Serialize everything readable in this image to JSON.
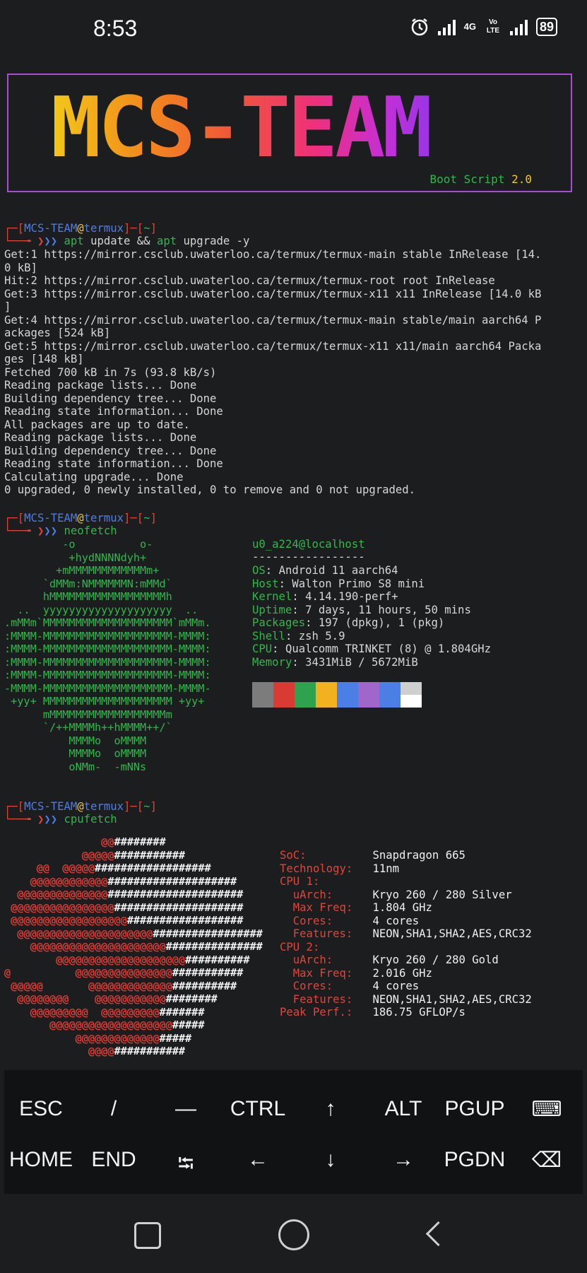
{
  "status_bar": {
    "time": "8:53",
    "network1": "4G",
    "network2": "Vo LTE",
    "battery": "89"
  },
  "banner": {
    "title": "MCS-TEAM",
    "subtitle_prefix": "Boot Script",
    "subtitle_version": "2.0"
  },
  "prompt": {
    "user": "MCS-TEAM",
    "at": "@",
    "host": "termux",
    "dir": "~"
  },
  "session1": {
    "cmd_apt1": "apt",
    "cmd_mid": " update && ",
    "cmd_apt2": "apt",
    "cmd_end": " upgrade -y",
    "output": [
      "Get:1 https://mirror.csclub.uwaterloo.ca/termux/termux-main stable InRelease [14.",
      "0 kB]",
      "Hit:2 https://mirror.csclub.uwaterloo.ca/termux/termux-root root InRelease",
      "Get:3 https://mirror.csclub.uwaterloo.ca/termux/termux-x11 x11 InRelease [14.0 kB",
      "]",
      "Get:4 https://mirror.csclub.uwaterloo.ca/termux/termux-main stable/main aarch64 P",
      "ackages [524 kB]",
      "Get:5 https://mirror.csclub.uwaterloo.ca/termux/termux-x11 x11/main aarch64 Packa",
      "ges [148 kB]",
      "Fetched 700 kB in 7s (93.8 kB/s)",
      "Reading package lists... Done",
      "Building dependency tree... Done",
      "Reading state information... Done",
      "All packages are up to date.",
      "Reading package lists... Done",
      "Building dependency tree... Done",
      "Reading state information... Done",
      "Calculating upgrade... Done",
      "0 upgraded, 0 newly installed, 0 to remove and 0 not upgraded."
    ]
  },
  "session2": {
    "cmd": "neofetch",
    "ascii": [
      "         -o          o-",
      "          +hydNNNNdyh+",
      "        +mMMMMMMMMMMMMm+",
      "      `dMMm:NMMMMMMN:mMMd`",
      "      hMMMMMMMMMMMMMMMMMMh",
      "  ..  yyyyyyyyyyyyyyyyyyyy  ..",
      ".mMMm`MMMMMMMMMMMMMMMMMMMM`mMMm.",
      ":MMMM-MMMMMMMMMMMMMMMMMMMM-MMMM:",
      ":MMMM-MMMMMMMMMMMMMMMMMMMM-MMMM:",
      ":MMMM-MMMMMMMMMMMMMMMMMMMM-MMMM:",
      ":MMMM-MMMMMMMMMMMMMMMMMMMM-MMMM:",
      "-MMMM-MMMMMMMMMMMMMMMMMMMM-MMMM-",
      " +yy+ MMMMMMMMMMMMMMMMMMMM +yy+",
      "      mMMMMMMMMMMMMMMMMMMm",
      "      `/++MMMMh++hMMMM++/`",
      "          MMMMo  oMMMM",
      "          MMMMo  oMMMM",
      "          oNMm-  -mNNs"
    ],
    "user_host": "u0_a224@localhost",
    "separator": "-----------------",
    "info": [
      {
        "k": "OS",
        "v": "Android 11 aarch64"
      },
      {
        "k": "Host",
        "v": "Walton Primo S8 mini"
      },
      {
        "k": "Kernel",
        "v": "4.14.190-perf+"
      },
      {
        "k": "Uptime",
        "v": "7 days, 11 hours, 50 mins"
      },
      {
        "k": "Packages",
        "v": "197 (dpkg), 1 (pkg)"
      },
      {
        "k": "Shell",
        "v": "zsh 5.9"
      },
      {
        "k": "CPU",
        "v": "Qualcomm TRINKET (8) @ 1.804GHz"
      },
      {
        "k": "Memory",
        "v": "3431MiB / 5672MiB"
      }
    ],
    "swatch_colors": [
      "#7c7c7c",
      "#d93b34",
      "#2ea24e",
      "#f2b21f",
      "#4b7fe6",
      "#a066cc",
      "#4b7fe6",
      "#cfcfcf"
    ],
    "swatch_bottom": [
      "#7c7c7c",
      "#d93b34",
      "#2ea24e",
      "#f2b21f",
      "#4b7fe6",
      "#a066cc",
      "#4b7fe6",
      "#ffffff"
    ]
  },
  "session3": {
    "cmd": "cpufetch",
    "art": [
      [
        "               ",
        "@@",
        "########"
      ],
      [
        "            ",
        "@@@@@",
        "###########"
      ],
      [
        "     ",
        "@@  @@@@@",
        "##################"
      ],
      [
        "    ",
        "@@@@@@@@@@@@",
        "####################"
      ],
      [
        "  ",
        "@@@@@@@@@@@@@@",
        "#####################"
      ],
      [
        " ",
        "@@@@@@@@@@@@@@@@",
        "####################"
      ],
      [
        " ",
        "@@@@@@@@@@@@@@@@@@",
        "##################"
      ],
      [
        "  ",
        "@@@@@@@@@@@@@@@@@@@@@",
        "#################"
      ],
      [
        "    ",
        "@@@@@@@@@@@@@@@@@@@@@",
        "###############"
      ],
      [
        "        ",
        "@@@@@@@@@@@@@@@@@@@@",
        "##########"
      ],
      [
        "",
        "@          @@@@@@@@@@@@@@@",
        "###########"
      ],
      [
        " ",
        "@@@@@       @@@@@@@@@@@@@",
        "##########"
      ],
      [
        "  ",
        "@@@@@@@@    @@@@@@@@@@@",
        "########"
      ],
      [
        "    ",
        "@@@@@@@@@  @@@@@@@@@",
        "#######"
      ],
      [
        "       ",
        "@@@@@@@@@@@@@@@@@@@",
        "#####"
      ],
      [
        "           ",
        "@@@@@@@@@@@@@",
        "#####"
      ],
      [
        "             ",
        "@@@@",
        "###########"
      ]
    ],
    "info": [
      {
        "k": "SoC:",
        "v": "Snapdragon 665"
      },
      {
        "k": "Technology:",
        "v": "11nm"
      },
      {
        "k": "CPU 1:",
        "v": ""
      },
      {
        "k": "  uArch:",
        "v": "Kryo 260 / 280 Silver"
      },
      {
        "k": "  Max Freq:",
        "v": "1.804 GHz"
      },
      {
        "k": "  Cores:",
        "v": "4 cores"
      },
      {
        "k": "  Features:",
        "v": "NEON,SHA1,SHA2,AES,CRC32"
      },
      {
        "k": "CPU 2:",
        "v": ""
      },
      {
        "k": "  uArch:",
        "v": "Kryo 260 / 280 Gold"
      },
      {
        "k": "  Max Freq:",
        "v": "2.016 GHz"
      },
      {
        "k": "  Cores:",
        "v": "4 cores"
      },
      {
        "k": "  Features:",
        "v": "NEON,SHA1,SHA2,AES,CRC32"
      },
      {
        "k": "Peak Perf.:",
        "v": "186.75 GFLOP/s"
      }
    ]
  },
  "extra_keys": {
    "row1": [
      "ESC",
      "/",
      "—",
      "CTRL",
      "↑",
      "ALT",
      "PGUP",
      "⌨"
    ],
    "row2": [
      "HOME",
      "END",
      "⭾",
      "←",
      "↓",
      "→",
      "PGDN",
      "⌫"
    ]
  }
}
